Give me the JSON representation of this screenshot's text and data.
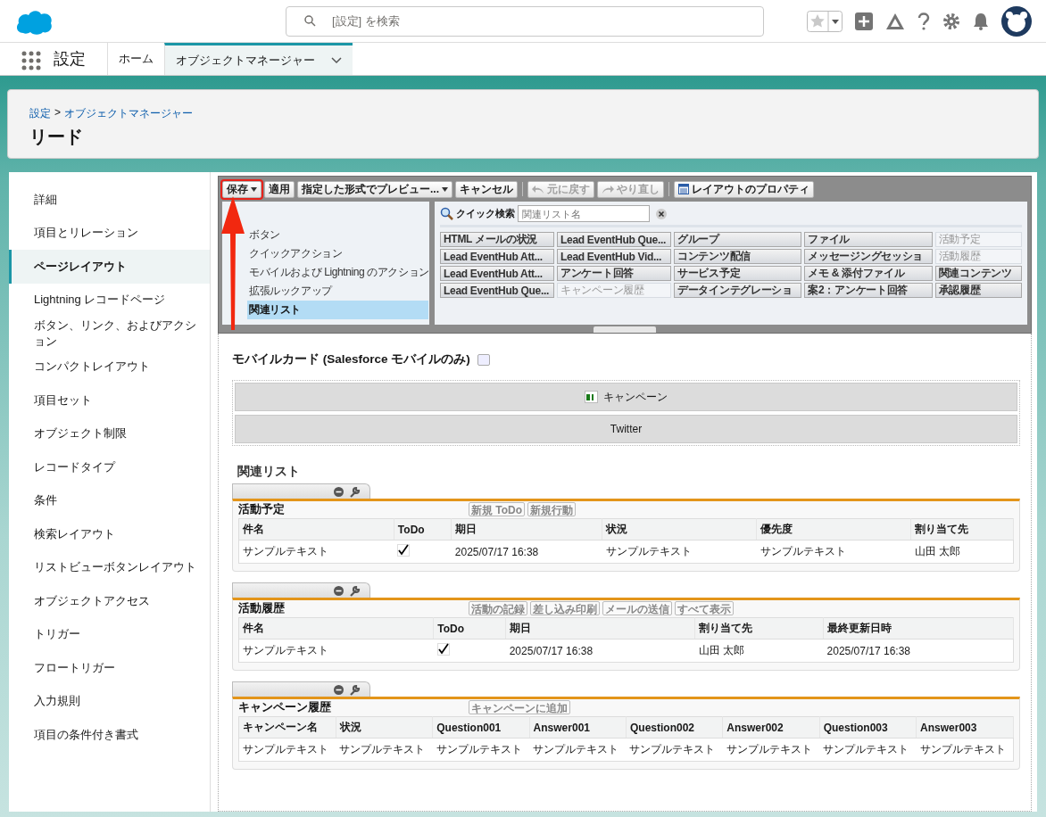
{
  "header": {
    "search": {
      "placeholder": "[設定] を検索"
    }
  },
  "nav": {
    "app_name": "設定",
    "tabs": [
      {
        "label": "ホーム",
        "selected": false
      },
      {
        "label": "オブジェクトマネージャー",
        "selected": true
      }
    ]
  },
  "page_header": {
    "breadcrumb": [
      "設定",
      "オブジェクトマネージャー"
    ],
    "breadcrumb_separator": ">",
    "title": "リード"
  },
  "sidebar": {
    "items": [
      {
        "label": "詳細",
        "selected": false
      },
      {
        "label": "項目とリレーション",
        "selected": false
      },
      {
        "label": "ページレイアウト",
        "selected": true
      },
      {
        "label": "Lightning レコードページ",
        "selected": false
      },
      {
        "label": "ボタン、リンク、およびアクション",
        "selected": false
      },
      {
        "label": "コンパクトレイアウト",
        "selected": false
      },
      {
        "label": "項目セット",
        "selected": false
      },
      {
        "label": "オブジェクト制限",
        "selected": false
      },
      {
        "label": "レコードタイプ",
        "selected": false
      },
      {
        "label": "条件",
        "selected": false
      },
      {
        "label": "検索レイアウト",
        "selected": false
      },
      {
        "label": "リストビューボタンレイアウト",
        "selected": false
      },
      {
        "label": "オブジェクトアクセス",
        "selected": false
      },
      {
        "label": "トリガー",
        "selected": false
      },
      {
        "label": "フロートリガー",
        "selected": false
      },
      {
        "label": "入力規則",
        "selected": false
      },
      {
        "label": "項目の条件付き書式",
        "selected": false
      }
    ]
  },
  "toolbar": {
    "buttons": [
      {
        "label": "保存",
        "kind": "split",
        "highlighted": true,
        "disabled": false
      },
      {
        "label": "適用",
        "kind": "plain",
        "highlighted": false,
        "disabled": false
      },
      {
        "label": "指定した形式でプレビュー...",
        "kind": "dropdown",
        "highlighted": false,
        "disabled": false
      },
      {
        "label": "キャンセル",
        "kind": "plain",
        "highlighted": false,
        "disabled": false
      },
      {
        "label": "元に戻す",
        "kind": "undo",
        "highlighted": false,
        "disabled": true
      },
      {
        "label": "やり直し",
        "kind": "redo",
        "highlighted": false,
        "disabled": true
      },
      {
        "label": "レイアウトのプロパティ",
        "kind": "properties",
        "highlighted": false,
        "disabled": false
      }
    ]
  },
  "palette": {
    "categories": [
      {
        "label": "ボタン",
        "selected": false
      },
      {
        "label": "クイックアクション",
        "selected": false
      },
      {
        "label": "モバイルおよび Lightning のアクション",
        "selected": false
      },
      {
        "label": "拡張ルックアップ",
        "selected": false
      },
      {
        "label": "関連リスト",
        "selected": true
      }
    ],
    "quick_search": {
      "label": "クイック検索",
      "placeholder": "関連リスト名"
    },
    "items": [
      {
        "label": "HTML メールの状況",
        "used": false
      },
      {
        "label": "Lead EventHub Que...",
        "used": false
      },
      {
        "label": "グループ",
        "used": false
      },
      {
        "label": "ファイル",
        "used": false
      },
      {
        "label": "活動予定",
        "used": true
      },
      {
        "label": "Lead EventHub Att...",
        "used": false
      },
      {
        "label": "Lead EventHub Vid...",
        "used": false
      },
      {
        "label": "コンテンツ配信",
        "used": false
      },
      {
        "label": "メッセージングセッショ",
        "used": false
      },
      {
        "label": "活動履歴",
        "used": true
      },
      {
        "label": "Lead EventHub Att...",
        "used": false
      },
      {
        "label": "アンケート回答",
        "used": false
      },
      {
        "label": "サービス予定",
        "used": false
      },
      {
        "label": "メモ & 添付ファイル",
        "used": false
      },
      {
        "label": "関連コンテンツ",
        "used": false
      },
      {
        "label": "Lead EventHub Que...",
        "used": false
      },
      {
        "label": "キャンペーン履歴",
        "used": true
      },
      {
        "label": "データインテグレーショ",
        "used": false
      },
      {
        "label": "案2：アンケート回答",
        "used": false
      },
      {
        "label": "承認履歴",
        "used": false
      }
    ]
  },
  "mobile_cards": {
    "title": "モバイルカード (Salesforce モバイルのみ)",
    "cards": [
      {
        "label": "キャンペーン",
        "kind": "lookup"
      },
      {
        "label": "Twitter",
        "kind": "plain"
      }
    ]
  },
  "related_lists": {
    "title": "関連リスト",
    "lists": [
      {
        "title": "活動予定",
        "buttons": [
          "新規 ToDo",
          "新規行動"
        ],
        "columns": [
          {
            "label": "件名",
            "kind": "text"
          },
          {
            "label": "ToDo",
            "kind": "check"
          },
          {
            "label": "期日",
            "kind": "text"
          },
          {
            "label": "状況",
            "kind": "text"
          },
          {
            "label": "優先度",
            "kind": "text"
          },
          {
            "label": "割り当て先",
            "kind": "text"
          }
        ],
        "rows": [
          [
            "サンプルテキスト",
            true,
            "2025/07/17 16:38",
            "サンプルテキスト",
            "サンプルテキスト",
            "山田 太郎"
          ]
        ]
      },
      {
        "title": "活動履歴",
        "buttons": [
          "活動の記録",
          "差し込み印刷",
          "メールの送信",
          "すべて表示"
        ],
        "columns": [
          {
            "label": "件名",
            "kind": "text"
          },
          {
            "label": "ToDo",
            "kind": "check"
          },
          {
            "label": "期日",
            "kind": "text"
          },
          {
            "label": "割り当て先",
            "kind": "text"
          },
          {
            "label": "最終更新日時",
            "kind": "text"
          }
        ],
        "rows": [
          [
            "サンプルテキスト",
            true,
            "2025/07/17 16:38",
            "山田 太郎",
            "2025/07/17 16:38"
          ]
        ]
      },
      {
        "title": "キャンペーン履歴",
        "buttons": [
          "キャンペーンに追加"
        ],
        "columns": [
          {
            "label": "キャンペーン名",
            "kind": "text"
          },
          {
            "label": "状況",
            "kind": "text"
          },
          {
            "label": "Question001",
            "kind": "text"
          },
          {
            "label": "Answer001",
            "kind": "text"
          },
          {
            "label": "Question002",
            "kind": "text"
          },
          {
            "label": "Answer002",
            "kind": "text"
          },
          {
            "label": "Question003",
            "kind": "text"
          },
          {
            "label": "Answer003",
            "kind": "text"
          }
        ],
        "rows": [
          [
            "サンプルテキスト",
            "サンプルテキスト",
            "サンプルテキスト",
            "サンプルテキスト",
            "サンプルテキスト",
            "サンプルテキスト",
            "サンプルテキスト",
            "サンプルテキスト"
          ]
        ]
      }
    ]
  }
}
